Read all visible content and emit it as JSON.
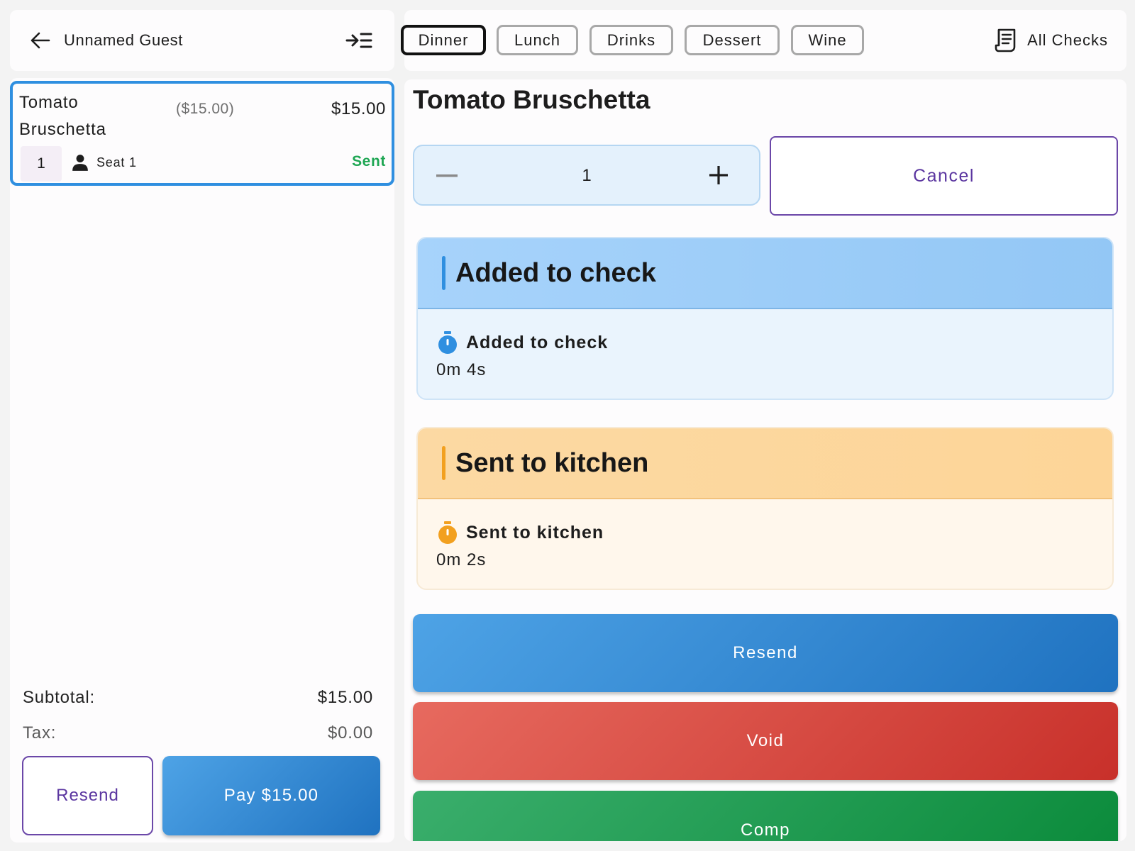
{
  "left_header": {
    "guest_name": "Unnamed Guest"
  },
  "order_items": [
    {
      "name": "Tomato Bruschetta",
      "original_price": "($15.00)",
      "price": "$15.00",
      "quantity": "1",
      "seat": "Seat 1",
      "status": "Sent"
    }
  ],
  "totals": {
    "subtotal_label": "Subtotal:",
    "subtotal_value": "$15.00",
    "tax_label": "Tax:",
    "tax_value": "$0.00"
  },
  "left_actions": {
    "resend_label": "Resend",
    "pay_label": "Pay $15.00"
  },
  "categories": {
    "tabs": [
      "Dinner",
      "Lunch",
      "Drinks",
      "Dessert",
      "Wine"
    ],
    "active": "Dinner",
    "all_checks_label": "All Checks"
  },
  "detail": {
    "title": "Tomato Bruschetta",
    "quantity": "1",
    "cancel_label": "Cancel"
  },
  "status_history": [
    {
      "heading": "Added to check",
      "event": "Added to check",
      "elapsed": "0m 4s",
      "color": "#2f8fe0"
    },
    {
      "heading": "Sent to kitchen",
      "event": "Sent to kitchen",
      "elapsed": "0m 2s",
      "color": "#f2a01f"
    }
  ],
  "actions": {
    "resend_label": "Resend",
    "void_label": "Void",
    "comp_label": "Comp"
  },
  "colors": {
    "selected_border": "#2f8fe0",
    "sent_green": "#1ea653",
    "accent_purple": "#5b36a0",
    "resend_blue": "#2a84d2",
    "void_red": "#d9463d",
    "comp_green": "#1e9a52"
  },
  "icons": {
    "back": "arrow-left-icon",
    "collapse": "collapse-panel-icon",
    "person": "person-icon",
    "receipt": "receipt-icon",
    "timer": "stopwatch-icon",
    "minus": "minus-icon",
    "plus": "plus-icon"
  }
}
